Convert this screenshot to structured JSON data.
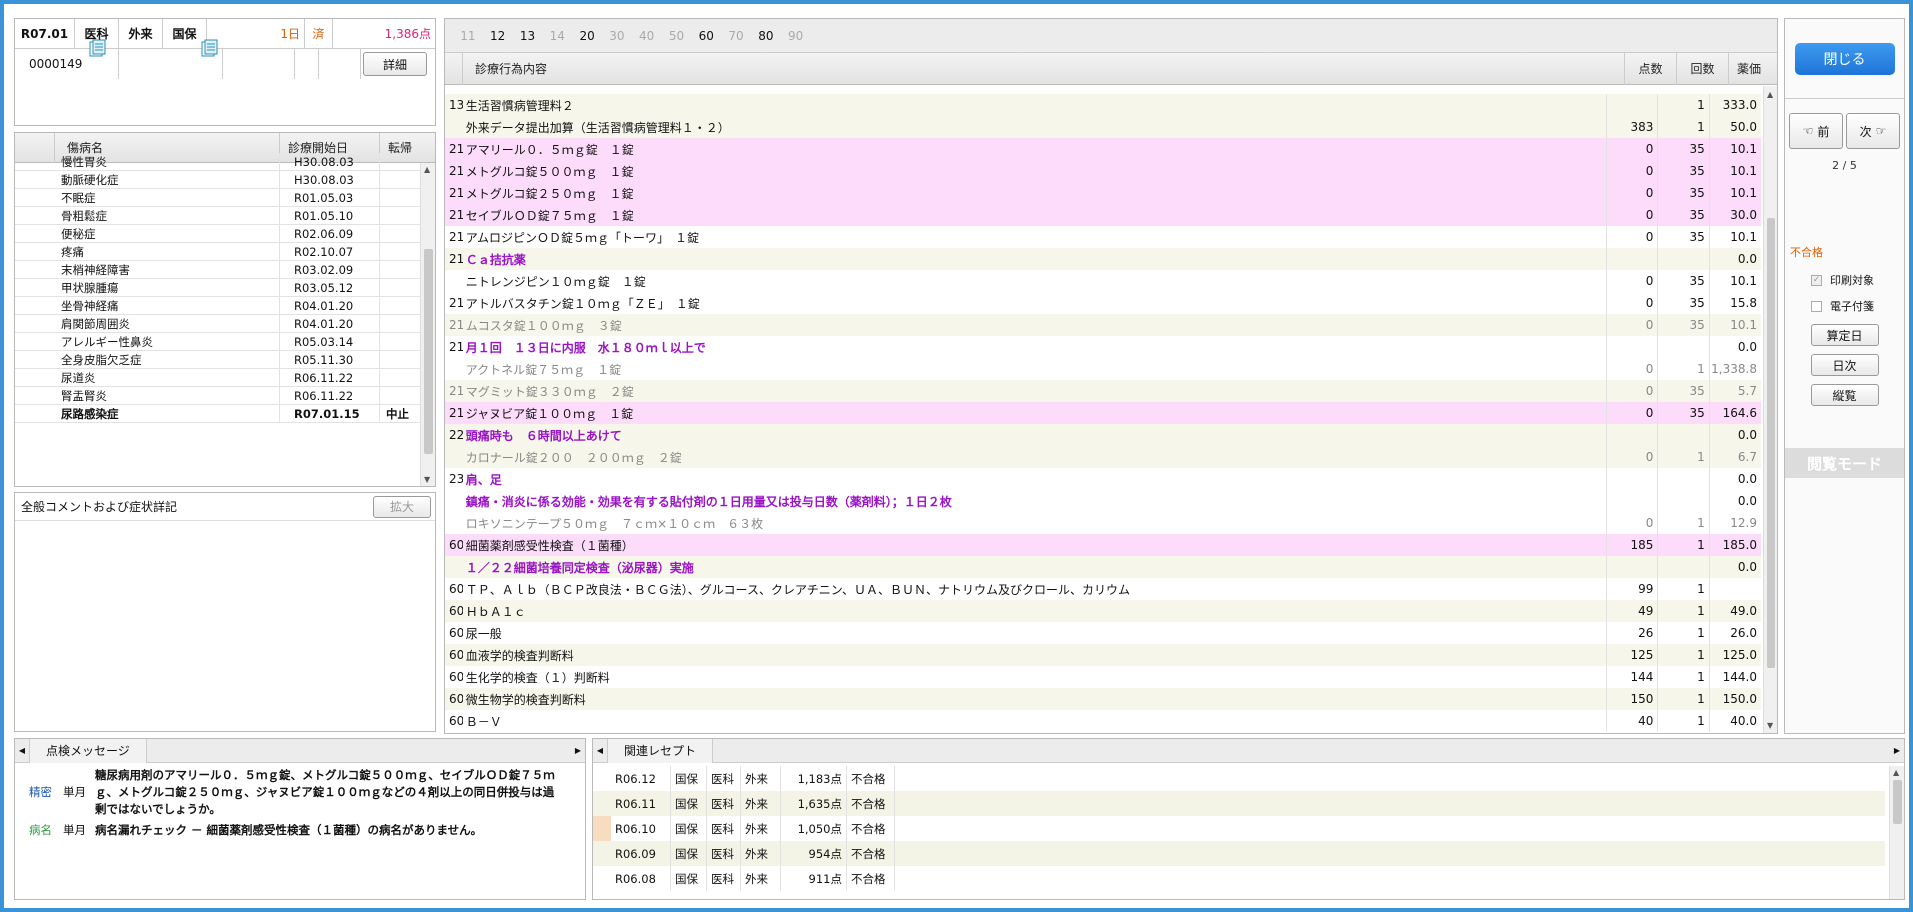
{
  "header": {
    "date": "R07.01",
    "dept": "医科",
    "visit": "外来",
    "insurance": "国保",
    "days": "1日",
    "status": "済",
    "points": "1,386点",
    "patient_id": "0000149",
    "detail_btn": "詳細"
  },
  "disease_table": {
    "headers": [
      "傷病名",
      "診療開始日",
      "転帰"
    ],
    "rows": [
      {
        "name": "慢性胃炎",
        "date": "H30.08.03",
        "outcome": "",
        "bold": false
      },
      {
        "name": "動脈硬化症",
        "date": "H30.08.03",
        "outcome": "",
        "bold": false
      },
      {
        "name": "不眠症",
        "date": "R01.05.03",
        "outcome": "",
        "bold": false
      },
      {
        "name": "骨粗鬆症",
        "date": "R01.05.10",
        "outcome": "",
        "bold": false
      },
      {
        "name": "便秘症",
        "date": "R02.06.09",
        "outcome": "",
        "bold": false
      },
      {
        "name": "疼痛",
        "date": "R02.10.07",
        "outcome": "",
        "bold": false
      },
      {
        "name": "末梢神経障害",
        "date": "R03.02.09",
        "outcome": "",
        "bold": false
      },
      {
        "name": "甲状腺腫瘍",
        "date": "R03.05.12",
        "outcome": "",
        "bold": false
      },
      {
        "name": "坐骨神経痛",
        "date": "R04.01.20",
        "outcome": "",
        "bold": false
      },
      {
        "name": "肩関節周囲炎",
        "date": "R04.01.20",
        "outcome": "",
        "bold": false
      },
      {
        "name": "アレルギー性鼻炎",
        "date": "R05.03.14",
        "outcome": "",
        "bold": false
      },
      {
        "name": "全身皮脂欠乏症",
        "date": "R05.11.30",
        "outcome": "",
        "bold": false
      },
      {
        "name": "尿道炎",
        "date": "R06.11.22",
        "outcome": "",
        "bold": false
      },
      {
        "name": "腎盂腎炎",
        "date": "R06.11.22",
        "outcome": "",
        "bold": false
      },
      {
        "name": "尿路感染症",
        "date": "R07.01.15",
        "outcome": "中止",
        "bold": true
      }
    ]
  },
  "comment": {
    "label": "全般コメントおよび症状詳記",
    "expand_btn": "拡大"
  },
  "tabs": [
    "11",
    "12",
    "13",
    "14",
    "20",
    "30",
    "40",
    "50",
    "60",
    "70",
    "80",
    "90"
  ],
  "tabs_active": [
    false,
    true,
    true,
    false,
    true,
    false,
    false,
    false,
    true,
    false,
    true,
    false
  ],
  "treatment_table": {
    "headers": [
      "診療行為内容",
      "点数",
      "回数",
      "薬価"
    ],
    "rows": [
      {
        "code": "13",
        "name": "生活習慣病管理料２",
        "points": "",
        "count": "1",
        "price": "333.0",
        "bg": "#f6f6ea",
        "style": ""
      },
      {
        "code": "",
        "name": "外来データ提出加算（生活習慣病管理料１・２）",
        "points": "383",
        "count": "1",
        "price": "50.0",
        "bg": "#f6f6ea",
        "style": ""
      },
      {
        "code": "21",
        "name": "アマリール０．５ｍｇ錠　１錠",
        "points": "0",
        "count": "35",
        "price": "10.1",
        "bg": "#fcdcfa",
        "style": ""
      },
      {
        "code": "21",
        "name": "メトグルコ錠５００ｍｇ　１錠",
        "points": "0",
        "count": "35",
        "price": "10.1",
        "bg": "#fcdcfa",
        "style": ""
      },
      {
        "code": "21",
        "name": "メトグルコ錠２５０ｍｇ　１錠",
        "points": "0",
        "count": "35",
        "price": "10.1",
        "bg": "#fcdcfa",
        "style": ""
      },
      {
        "code": "21",
        "name": "セイブルＯＤ錠７５ｍｇ　１錠",
        "points": "0",
        "count": "35",
        "price": "30.0",
        "bg": "#fcdcfa",
        "style": ""
      },
      {
        "code": "21",
        "name": "アムロジピンＯＤ錠５ｍｇ「トーワ」　１錠",
        "points": "0",
        "count": "35",
        "price": "10.1",
        "bg": "#ffffff",
        "style": ""
      },
      {
        "code": "21",
        "name": "Ｃａ拮抗薬",
        "points": "",
        "count": "",
        "price": "0.0",
        "bg": "#f6f6ea",
        "style": "purple"
      },
      {
        "code": "",
        "name": "ニトレンジピン１０ｍｇ錠　１錠",
        "points": "0",
        "count": "35",
        "price": "10.1",
        "bg": "#ffffff",
        "style": ""
      },
      {
        "code": "21",
        "name": "アトルバスタチン錠１０ｍｇ「ＺＥ」　１錠",
        "points": "0",
        "count": "35",
        "price": "15.8",
        "bg": "#ffffff",
        "style": ""
      },
      {
        "code": "21",
        "name": "ムコスタ錠１００ｍｇ　３錠",
        "points": "0",
        "count": "35",
        "price": "10.1",
        "bg": "#f6f6ea",
        "style": "gray"
      },
      {
        "code": "21",
        "name": "月１回　１３日に内服　水１８０ｍｌ以上で",
        "points": "",
        "count": "",
        "price": "0.0",
        "bg": "#ffffff",
        "style": "purple"
      },
      {
        "code": "",
        "name": "アクトネル錠７５ｍｇ　１錠",
        "points": "0",
        "count": "1",
        "price": "1,338.8",
        "bg": "#ffffff",
        "style": "gray"
      },
      {
        "code": "21",
        "name": "マグミット錠３３０ｍｇ　２錠",
        "points": "0",
        "count": "35",
        "price": "5.7",
        "bg": "#f6f6ea",
        "style": "gray"
      },
      {
        "code": "21",
        "name": "ジャヌビア錠１００ｍｇ　１錠",
        "points": "0",
        "count": "35",
        "price": "164.6",
        "bg": "#fcdcfa",
        "style": ""
      },
      {
        "code": "22",
        "name": "頭痛時も　６時間以上あけて",
        "points": "",
        "count": "",
        "price": "0.0",
        "bg": "#f6f6ea",
        "style": "purple"
      },
      {
        "code": "",
        "name": "カロナール錠２００　２００ｍｇ　２錠",
        "points": "0",
        "count": "1",
        "price": "6.7",
        "bg": "#f6f6ea",
        "style": "gray"
      },
      {
        "code": "23",
        "name": "肩、足",
        "points": "",
        "count": "",
        "price": "0.0",
        "bg": "#ffffff",
        "style": "purple"
      },
      {
        "code": "",
        "name": "鎮痛・消炎に係る効能・効果を有する貼付剤の１日用量又は投与日数（薬剤料）；１日２枚",
        "points": "",
        "count": "",
        "price": "0.0",
        "bg": "#ffffff",
        "style": "purple"
      },
      {
        "code": "",
        "name": "ロキソニンテープ５０ｍｇ　７ｃｍ×１０ｃｍ　６３枚",
        "points": "0",
        "count": "1",
        "price": "12.9",
        "bg": "#ffffff",
        "style": "gray"
      },
      {
        "code": "60",
        "name": "細菌薬剤感受性検査（１菌種）",
        "points": "185",
        "count": "1",
        "price": "185.0",
        "bg": "#fcdcfa",
        "style": ""
      },
      {
        "code": "",
        "name": "１／２２細菌培養同定検査（泌尿器）実施",
        "points": "",
        "count": "",
        "price": "0.0",
        "bg": "#f6f6ea",
        "style": "purple"
      },
      {
        "code": "60",
        "name": "ＴＰ、Ａｌｂ（ＢＣＰ改良法・ＢＣＧ法）、グルコース、クレアチニン、ＵＡ、ＢＵＮ、ナトリウム及びクロール、カリウム",
        "points": "99",
        "count": "1",
        "price": "",
        "bg": "#ffffff",
        "style": ""
      },
      {
        "code": "60",
        "name": "ＨｂＡ１ｃ",
        "points": "49",
        "count": "1",
        "price": "49.0",
        "bg": "#f6f6ea",
        "style": ""
      },
      {
        "code": "60",
        "name": "尿一般",
        "points": "26",
        "count": "1",
        "price": "26.0",
        "bg": "#ffffff",
        "style": ""
      },
      {
        "code": "60",
        "name": "血液学的検査判断料",
        "points": "125",
        "count": "1",
        "price": "125.0",
        "bg": "#f6f6ea",
        "style": ""
      },
      {
        "code": "60",
        "name": "生化学的検査（１）判断料",
        "points": "144",
        "count": "1",
        "price": "144.0",
        "bg": "#ffffff",
        "style": ""
      },
      {
        "code": "60",
        "name": "微生物学的検査判断料",
        "points": "150",
        "count": "1",
        "price": "150.0",
        "bg": "#f6f6ea",
        "style": ""
      },
      {
        "code": "60",
        "name": "Ｂ－Ｖ",
        "points": "40",
        "count": "1",
        "price": "40.0",
        "bg": "#ffffff",
        "style": ""
      }
    ]
  },
  "right_panel": {
    "close_btn": "閉じる",
    "prev_btn": "前",
    "next_btn": "次",
    "page": "2 / 5",
    "status": "不合格",
    "print_target": "印刷対象",
    "electronic": "電子付箋",
    "calc_day_btn": "算定日",
    "daily_btn": "日次",
    "overview_btn": "縦覧",
    "view_mode": "閲覧モード"
  },
  "messages": {
    "tab": "点検メッセージ",
    "items": [
      {
        "type": "精密",
        "period": "単月",
        "text": "糖尿病用剤のアマリール０．５ｍｇ錠、メトグルコ錠５００ｍｇ、セイブルＯＤ錠７５ｍｇ、メトグルコ錠２５０ｍｇ、ジャヌビア錠１００ｍｇなどの４剤以上の同日併投与は過剰ではないでしょうか。",
        "color": "#1a56b8"
      },
      {
        "type": "病名",
        "period": "単月",
        "text": "病名漏れチェック － 細菌薬剤感受性検査（１菌種）の病名がありません。",
        "color": "#2a9a3a"
      }
    ]
  },
  "related": {
    "tab": "関連レセプト",
    "rows": [
      {
        "date": "R06.12",
        "ins": "国保",
        "dept": "医科",
        "visit": "外来",
        "points": "1,183点",
        "status": "不合格",
        "bg": "#ffffff"
      },
      {
        "date": "R06.11",
        "ins": "国保",
        "dept": "医科",
        "visit": "外来",
        "points": "1,635点",
        "status": "不合格",
        "bg": "#f3f3e6"
      },
      {
        "date": "R06.10",
        "ins": "国保",
        "dept": "医科",
        "visit": "外来",
        "points": "1,050点",
        "status": "不合格",
        "bg": "#ffffff"
      },
      {
        "date": "R06.09",
        "ins": "国保",
        "dept": "医科",
        "visit": "外来",
        "points": "954点",
        "status": "不合格",
        "bg": "#f3f3e6"
      },
      {
        "date": "R06.08",
        "ins": "国保",
        "dept": "医科",
        "visit": "外来",
        "points": "911点",
        "status": "不合格",
        "bg": "#ffffff"
      }
    ]
  }
}
